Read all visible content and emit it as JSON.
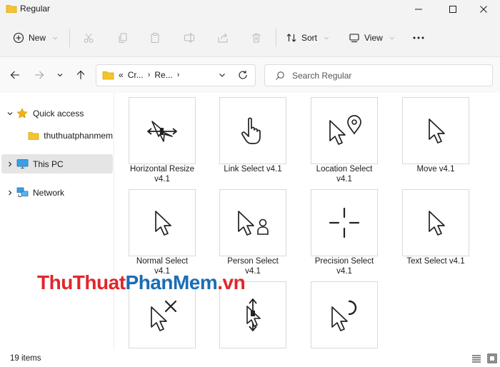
{
  "window": {
    "title": "Regular",
    "controls": [
      "minimize-icon",
      "maximize-icon",
      "close-icon"
    ]
  },
  "toolbar": {
    "new_label": "New",
    "sort_label": "Sort",
    "view_label": "View",
    "icons": [
      "cut-icon",
      "copy-icon",
      "paste-icon",
      "rename-icon",
      "share-icon",
      "delete-icon",
      "more-icon"
    ]
  },
  "address": {
    "overflow": "«",
    "crumb1": "Cr...",
    "crumb2": "Re..."
  },
  "search": {
    "placeholder": "Search Regular"
  },
  "sidebar": {
    "items": [
      {
        "label": "Quick access",
        "icon": "star-icon"
      },
      {
        "label": "thuthuatphanmem",
        "icon": "folder-icon"
      },
      {
        "label": "This PC",
        "icon": "computer-icon"
      },
      {
        "label": "Network",
        "icon": "network-icon"
      }
    ]
  },
  "files": [
    {
      "line1": "Horizontal Resize",
      "line2": "v4.1",
      "icon": "horizontal-resize-cursor-icon"
    },
    {
      "line1": "Link Select v4.1",
      "line2": "",
      "icon": "link-select-cursor-icon"
    },
    {
      "line1": "Location Select",
      "line2": "v4.1",
      "icon": "location-select-cursor-icon"
    },
    {
      "line1": "Move v4.1",
      "line2": "",
      "icon": "move-cursor-icon"
    },
    {
      "line1": "Normal Select",
      "line2": "v4.1",
      "icon": "normal-select-cursor-icon"
    },
    {
      "line1": "Person Select",
      "line2": "v4.1",
      "icon": "person-select-cursor-icon"
    },
    {
      "line1": "Precision Select",
      "line2": "v4.1",
      "icon": "precision-select-cursor-icon"
    },
    {
      "line1": "Text Select v4.1",
      "line2": "",
      "icon": "text-select-cursor-icon"
    },
    {
      "line1": "",
      "line2": "",
      "icon": "unavailable-cursor-icon"
    },
    {
      "line1": "",
      "line2": "",
      "icon": "vertical-resize-cursor-icon"
    },
    {
      "line1": "",
      "line2": "",
      "icon": "working-cursor-icon"
    }
  ],
  "watermark": {
    "part1": "ThuThuat",
    "part2": "PhanMem",
    "part3": ".vn"
  },
  "status": {
    "count": "19 items"
  },
  "colors": {
    "folder": "#f4c430",
    "accent": "#0067c0",
    "watermark_red": "#e1262c",
    "watermark_blue": "#1b6db4",
    "star": "#e8b51a"
  }
}
